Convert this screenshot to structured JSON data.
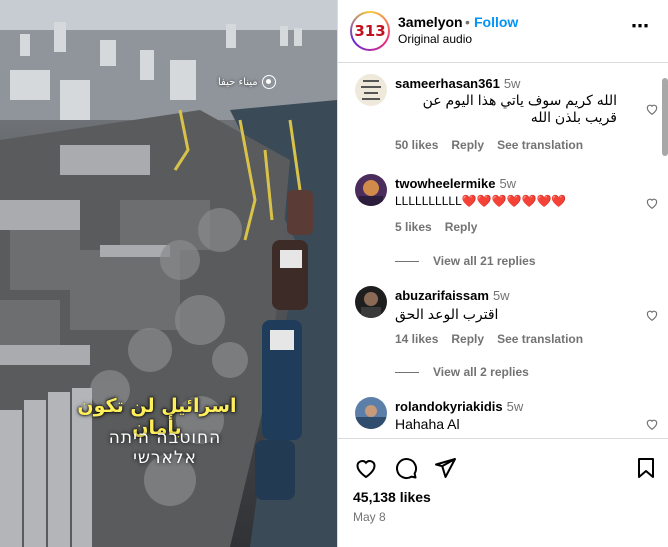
{
  "post": {
    "location_tag": "ميناء حيفا",
    "caption_line1": "اسرائيل لن تكون بأمان",
    "caption_line2": "החוטבה היתה אלארשי"
  },
  "header": {
    "avatar_text": "313",
    "username": "3amelyon",
    "separator": "•",
    "follow_label": "Follow",
    "audio": "Original audio",
    "more": "⋯"
  },
  "comments": [
    {
      "username": "sameerhasan361",
      "time": "5w",
      "text": "الله كريم سوف ياتي هذا اليوم عن قريب بلذن الله",
      "likes": "50 likes",
      "reply_label": "Reply",
      "translate_label": "See translation"
    },
    {
      "username": "twowheelermike",
      "time": "5w",
      "text": "LLLLLLLLLL❤️❤️❤️❤️❤️❤️❤️",
      "likes": "5 likes",
      "reply_label": "Reply",
      "view_replies": "View all 21 replies"
    },
    {
      "username": "abuzarifaissam",
      "time": "5w",
      "text": "اقترب الوعد الحق",
      "likes": "14 likes",
      "reply_label": "Reply",
      "translate_label": "See translation",
      "view_replies": "View all 2 replies"
    },
    {
      "username": "rolandokyriakidis",
      "time": "5w",
      "text": "Hahaha Al"
    }
  ],
  "footer": {
    "likes": "45,138 likes",
    "date": "May 8"
  },
  "colors": {
    "link_blue": "#0095f6",
    "muted": "#737373",
    "border": "#dbdbdb",
    "caption_yellow": "#ffef5a"
  },
  "icons": [
    "heart-icon",
    "comment-icon",
    "share-icon",
    "bookmark-icon",
    "more-icon"
  ]
}
